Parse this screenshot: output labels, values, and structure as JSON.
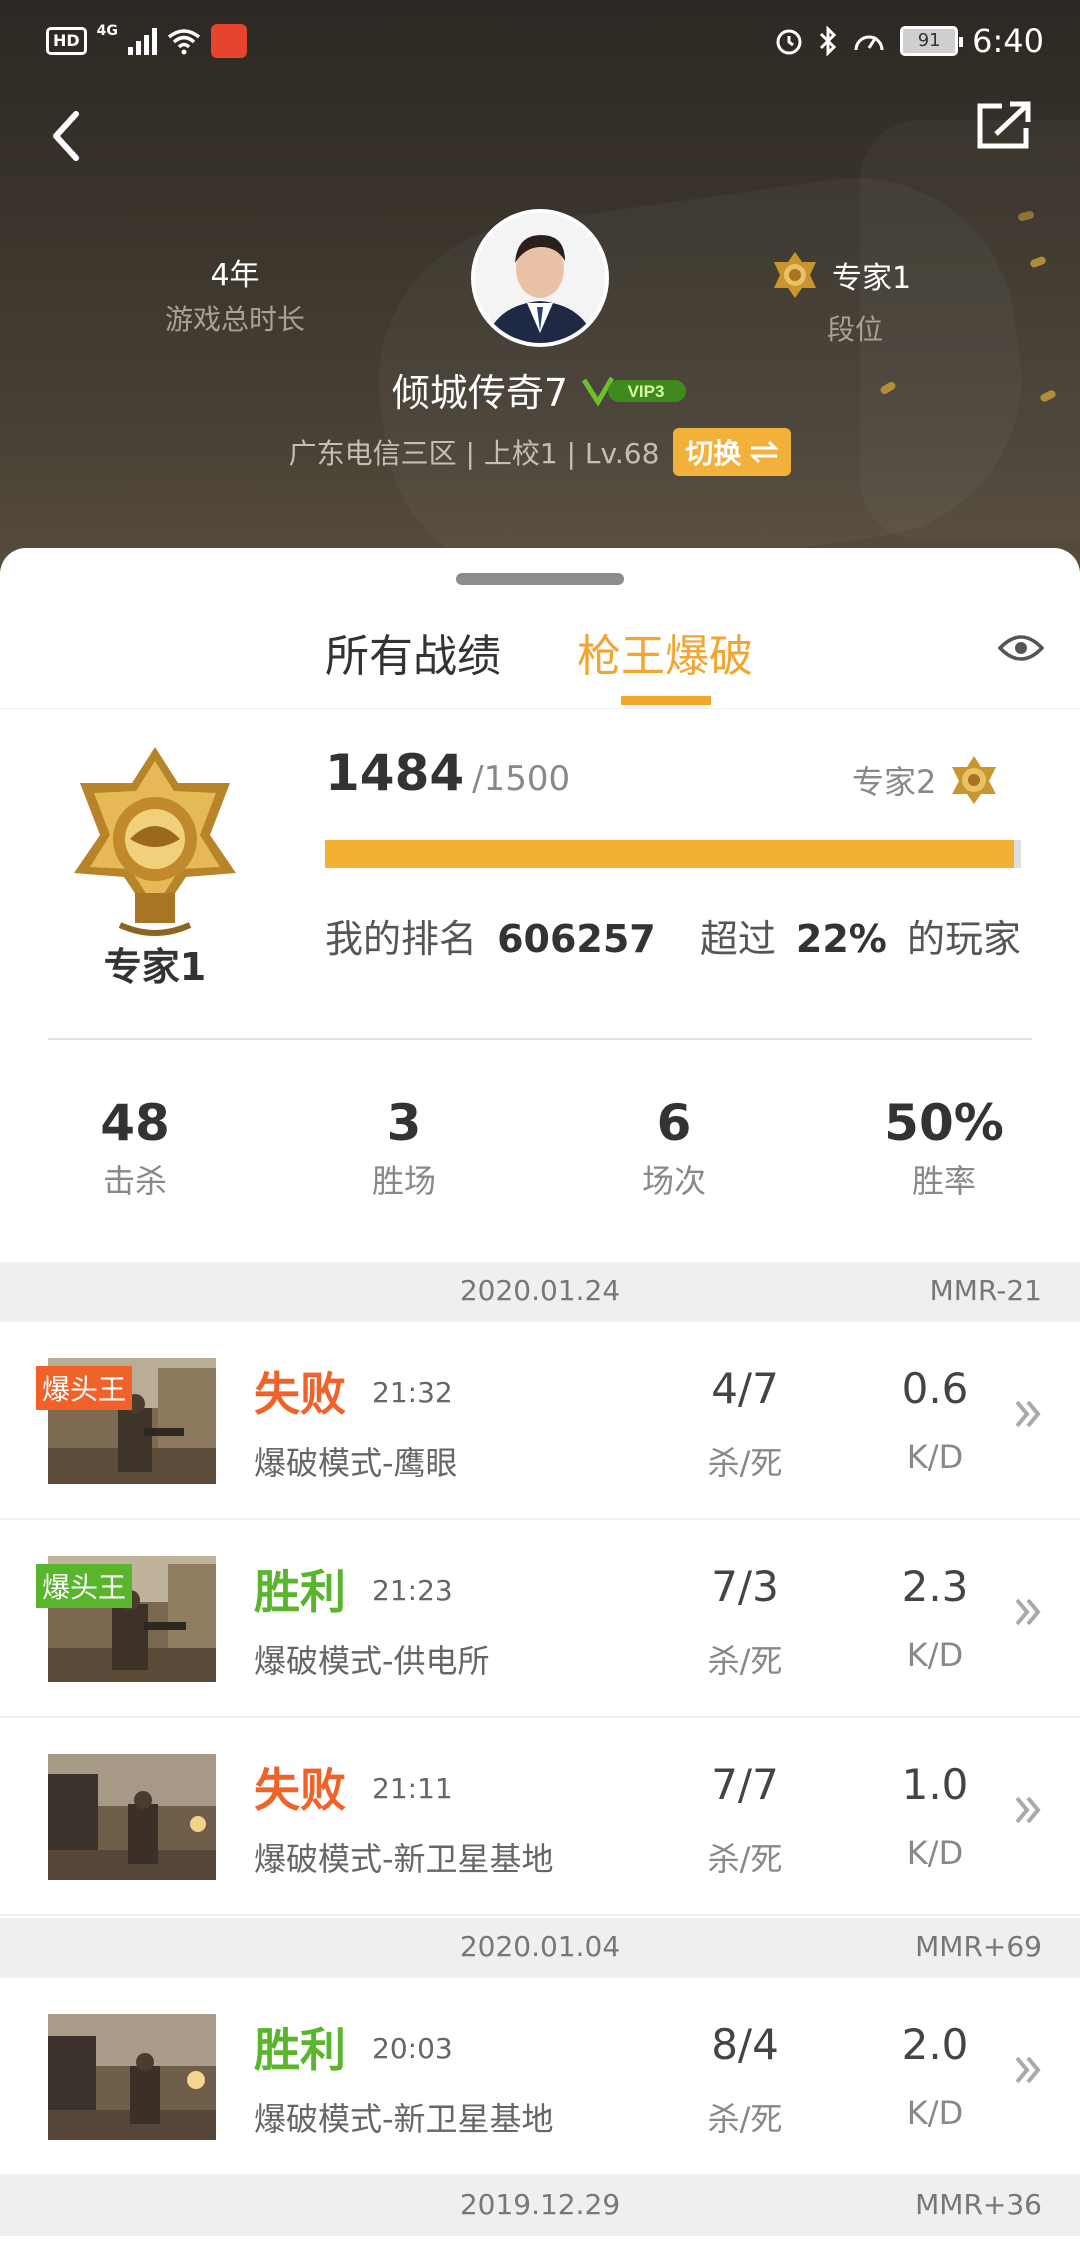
{
  "status_bar": {
    "hd": "HD",
    "network": "4G",
    "battery": "91",
    "time": "6:40"
  },
  "profile": {
    "play_duration_value": "4年",
    "play_duration_label": "游戏总时长",
    "rank_value": "专家1",
    "rank_label": "段位",
    "nickname": "倾城传奇7",
    "vip_badge": "VIP3",
    "server_info": "广东电信三区 | 上校1 | Lv.68",
    "switch_label": "切换"
  },
  "tabs": {
    "all": "所有战绩",
    "selected": "枪王爆破"
  },
  "rank_panel": {
    "rank_name": "专家1",
    "score": "1484",
    "score_max": "/1500",
    "progress": 0.99,
    "next_rank": "专家2",
    "ranking_label": "我的排名",
    "ranking_value": "606257",
    "exceed_prefix": "超过",
    "exceed_value": "22%",
    "exceed_suffix": "的玩家"
  },
  "summary": [
    {
      "value": "48",
      "label": "击杀"
    },
    {
      "value": "3",
      "label": "胜场"
    },
    {
      "value": "6",
      "label": "场次"
    },
    {
      "value": "50%",
      "label": "胜率"
    }
  ],
  "groups": [
    {
      "date": "2020.01.24",
      "mmr": "MMR-21",
      "matches": [
        {
          "tag": "爆头王",
          "tag_color": "#f0622a",
          "result": "失败",
          "time": "21:32",
          "mode": "爆破模式-鹰眼",
          "kills_deaths": "4/7",
          "kd_label": "杀/死",
          "kd": "0.6",
          "kd_ratio_label": "K/D"
        },
        {
          "tag": "爆头王",
          "tag_color": "#58b52c",
          "result": "胜利",
          "time": "21:23",
          "mode": "爆破模式-供电所",
          "kills_deaths": "7/3",
          "kd_label": "杀/死",
          "kd": "2.3",
          "kd_ratio_label": "K/D"
        },
        {
          "result": "失败",
          "time": "21:11",
          "mode": "爆破模式-新卫星基地",
          "kills_deaths": "7/7",
          "kd_label": "杀/死",
          "kd": "1.0",
          "kd_ratio_label": "K/D"
        }
      ]
    },
    {
      "date": "2020.01.04",
      "mmr": "MMR+69",
      "matches": [
        {
          "result": "胜利",
          "time": "20:03",
          "mode": "爆破模式-新卫星基地",
          "kills_deaths": "8/4",
          "kd_label": "杀/死",
          "kd": "2.0",
          "kd_ratio_label": "K/D"
        }
      ]
    },
    {
      "date": "2019.12.29",
      "mmr": "MMR+36",
      "matches": []
    }
  ],
  "colors": {
    "accent": "#f2a531",
    "lose": "#f0622a",
    "win": "#58b52c"
  },
  "icons": [
    "back-arrow-icon",
    "share-icon",
    "eye-icon",
    "rank-emblem-icon",
    "chevron-right-icon",
    "vip-icon"
  ]
}
